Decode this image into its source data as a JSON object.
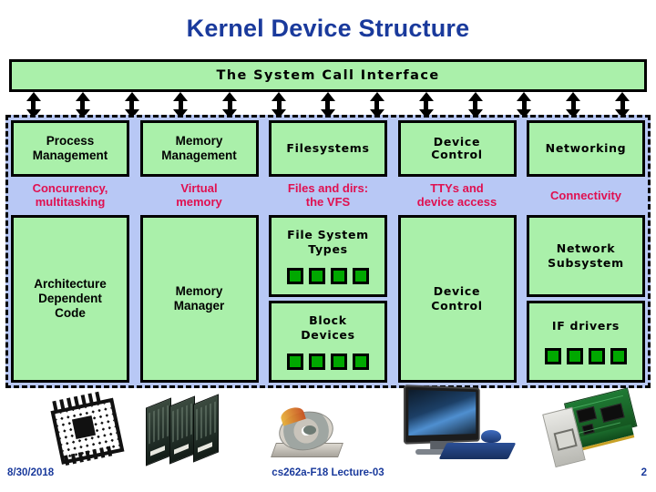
{
  "slide": {
    "title": "Kernel Device Structure",
    "syscall_banner": "The System Call Interface",
    "arrow_count": 13
  },
  "colors": {
    "title_blue": "#1a3a9c",
    "box_green": "#aaf0aa",
    "kernel_blue": "#b8c8f5",
    "caption_pink": "#e01050",
    "chip_green": "#00a800",
    "outline_black": "#000000"
  },
  "columns": [
    {
      "head": "Process\nManagement",
      "head_label": "Process Management",
      "head_font": "sans",
      "caption": "Concurrency,\nmultitasking",
      "caption_label": "Concurrency, multitasking",
      "caption_font": "sans",
      "boxes": [
        {
          "label": "Architecture\nDependent\nCode",
          "text": "Architecture Dependent Code",
          "font": "sans",
          "chips": 0,
          "flex": 1
        }
      ]
    },
    {
      "head": "Memory\nManagement",
      "head_label": "Memory Management",
      "head_font": "sans",
      "caption": "Virtual\nmemory",
      "caption_label": "Virtual memory",
      "caption_font": "sans",
      "boxes": [
        {
          "label": "Memory\nManager",
          "text": "Memory Manager",
          "font": "sans",
          "chips": 0,
          "flex": 1
        }
      ]
    },
    {
      "head": "Filesystems",
      "head_label": "Filesystems",
      "head_font": "comic",
      "caption": "Files and dirs:\nthe VFS",
      "caption_label": "Files and dirs: the VFS",
      "caption_font": "sans",
      "boxes": [
        {
          "label": "File System\nTypes",
          "text": "File System Types",
          "font": "comic",
          "chips": 4,
          "flex": 1
        },
        {
          "label": "Block\nDevices",
          "text": "Block Devices",
          "font": "comic",
          "chips": 4,
          "flex": 1
        }
      ]
    },
    {
      "head": "Device\nControl",
      "head_label": "Device Control",
      "head_font": "comic",
      "caption": "TTYs and\ndevice access",
      "caption_label": "TTYs and device access",
      "caption_font": "sans",
      "boxes": [
        {
          "label": "Device\nControl",
          "text": "Device Control",
          "font": "comic",
          "chips": 0,
          "flex": 1
        }
      ]
    },
    {
      "head": "Networking",
      "head_label": "Networking",
      "head_font": "comic",
      "caption": "Connectivity",
      "caption_label": "Connectivity",
      "caption_font": "sans",
      "boxes": [
        {
          "label": "Network\nSubsystem",
          "text": "Network Subsystem",
          "font": "comic",
          "chips": 0,
          "flex": 1
        },
        {
          "label": "IF drivers",
          "text": "IF drivers",
          "font": "comic",
          "chips": 4,
          "flex": 1
        }
      ]
    }
  ],
  "hardware": [
    {
      "icon": "cpu-chip-image",
      "label": "CPU chip"
    },
    {
      "icon": "memory-modules-image",
      "label": "RAM modules"
    },
    {
      "icon": "disk-storage-image",
      "label": "Disk storage"
    },
    {
      "icon": "monitor-image",
      "label": "Monitor, keyboard and mouse"
    },
    {
      "icon": "network-card-image",
      "label": "Network interface card"
    }
  ],
  "footer": {
    "date": "8/30/2018",
    "course": "cs262a-F18 Lecture-03",
    "page": "2"
  }
}
